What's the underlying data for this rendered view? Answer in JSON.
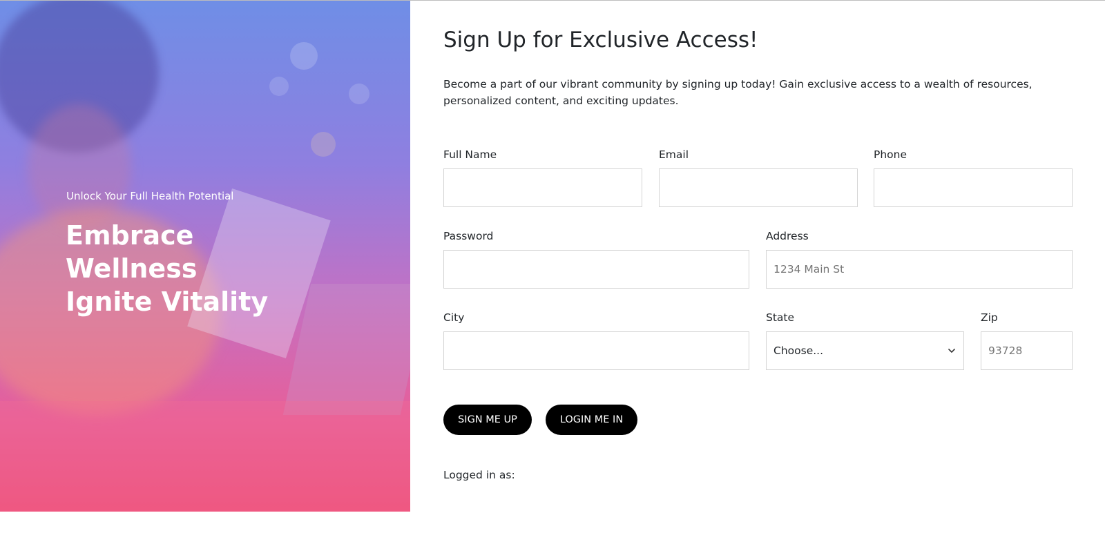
{
  "hero": {
    "subtitle": "Unlock Your Full Health Potential",
    "title_lines": [
      "Embrace",
      "Wellness",
      "Ignite Vitality"
    ],
    "image": "woman-with-laptop-photo"
  },
  "form": {
    "title": "Sign Up for Exclusive Access!",
    "description": "Become a part of our vibrant community by signing up today! Gain exclusive access to a wealth of resources, personalized content, and exciting updates.",
    "fields": {
      "full_name": {
        "label": "Full Name",
        "value": "",
        "placeholder": ""
      },
      "email": {
        "label": "Email",
        "value": "",
        "placeholder": ""
      },
      "phone": {
        "label": "Phone",
        "value": "",
        "placeholder": ""
      },
      "password": {
        "label": "Password",
        "value": "",
        "placeholder": ""
      },
      "address": {
        "label": "Address",
        "value": "",
        "placeholder": "1234 Main St"
      },
      "city": {
        "label": "City",
        "value": "",
        "placeholder": ""
      },
      "state": {
        "label": "State",
        "selected": "Choose..."
      },
      "zip": {
        "label": "Zip",
        "value": "",
        "placeholder": "93728"
      }
    },
    "buttons": {
      "signup": "SIGN ME UP",
      "login": "LOGIN ME IN"
    },
    "logged_in_label": "Logged in as:"
  },
  "colors": {
    "button_bg": "#000000",
    "hero_gradient_top": "#6f8ee6",
    "hero_gradient_bottom": "#ee4d77"
  }
}
